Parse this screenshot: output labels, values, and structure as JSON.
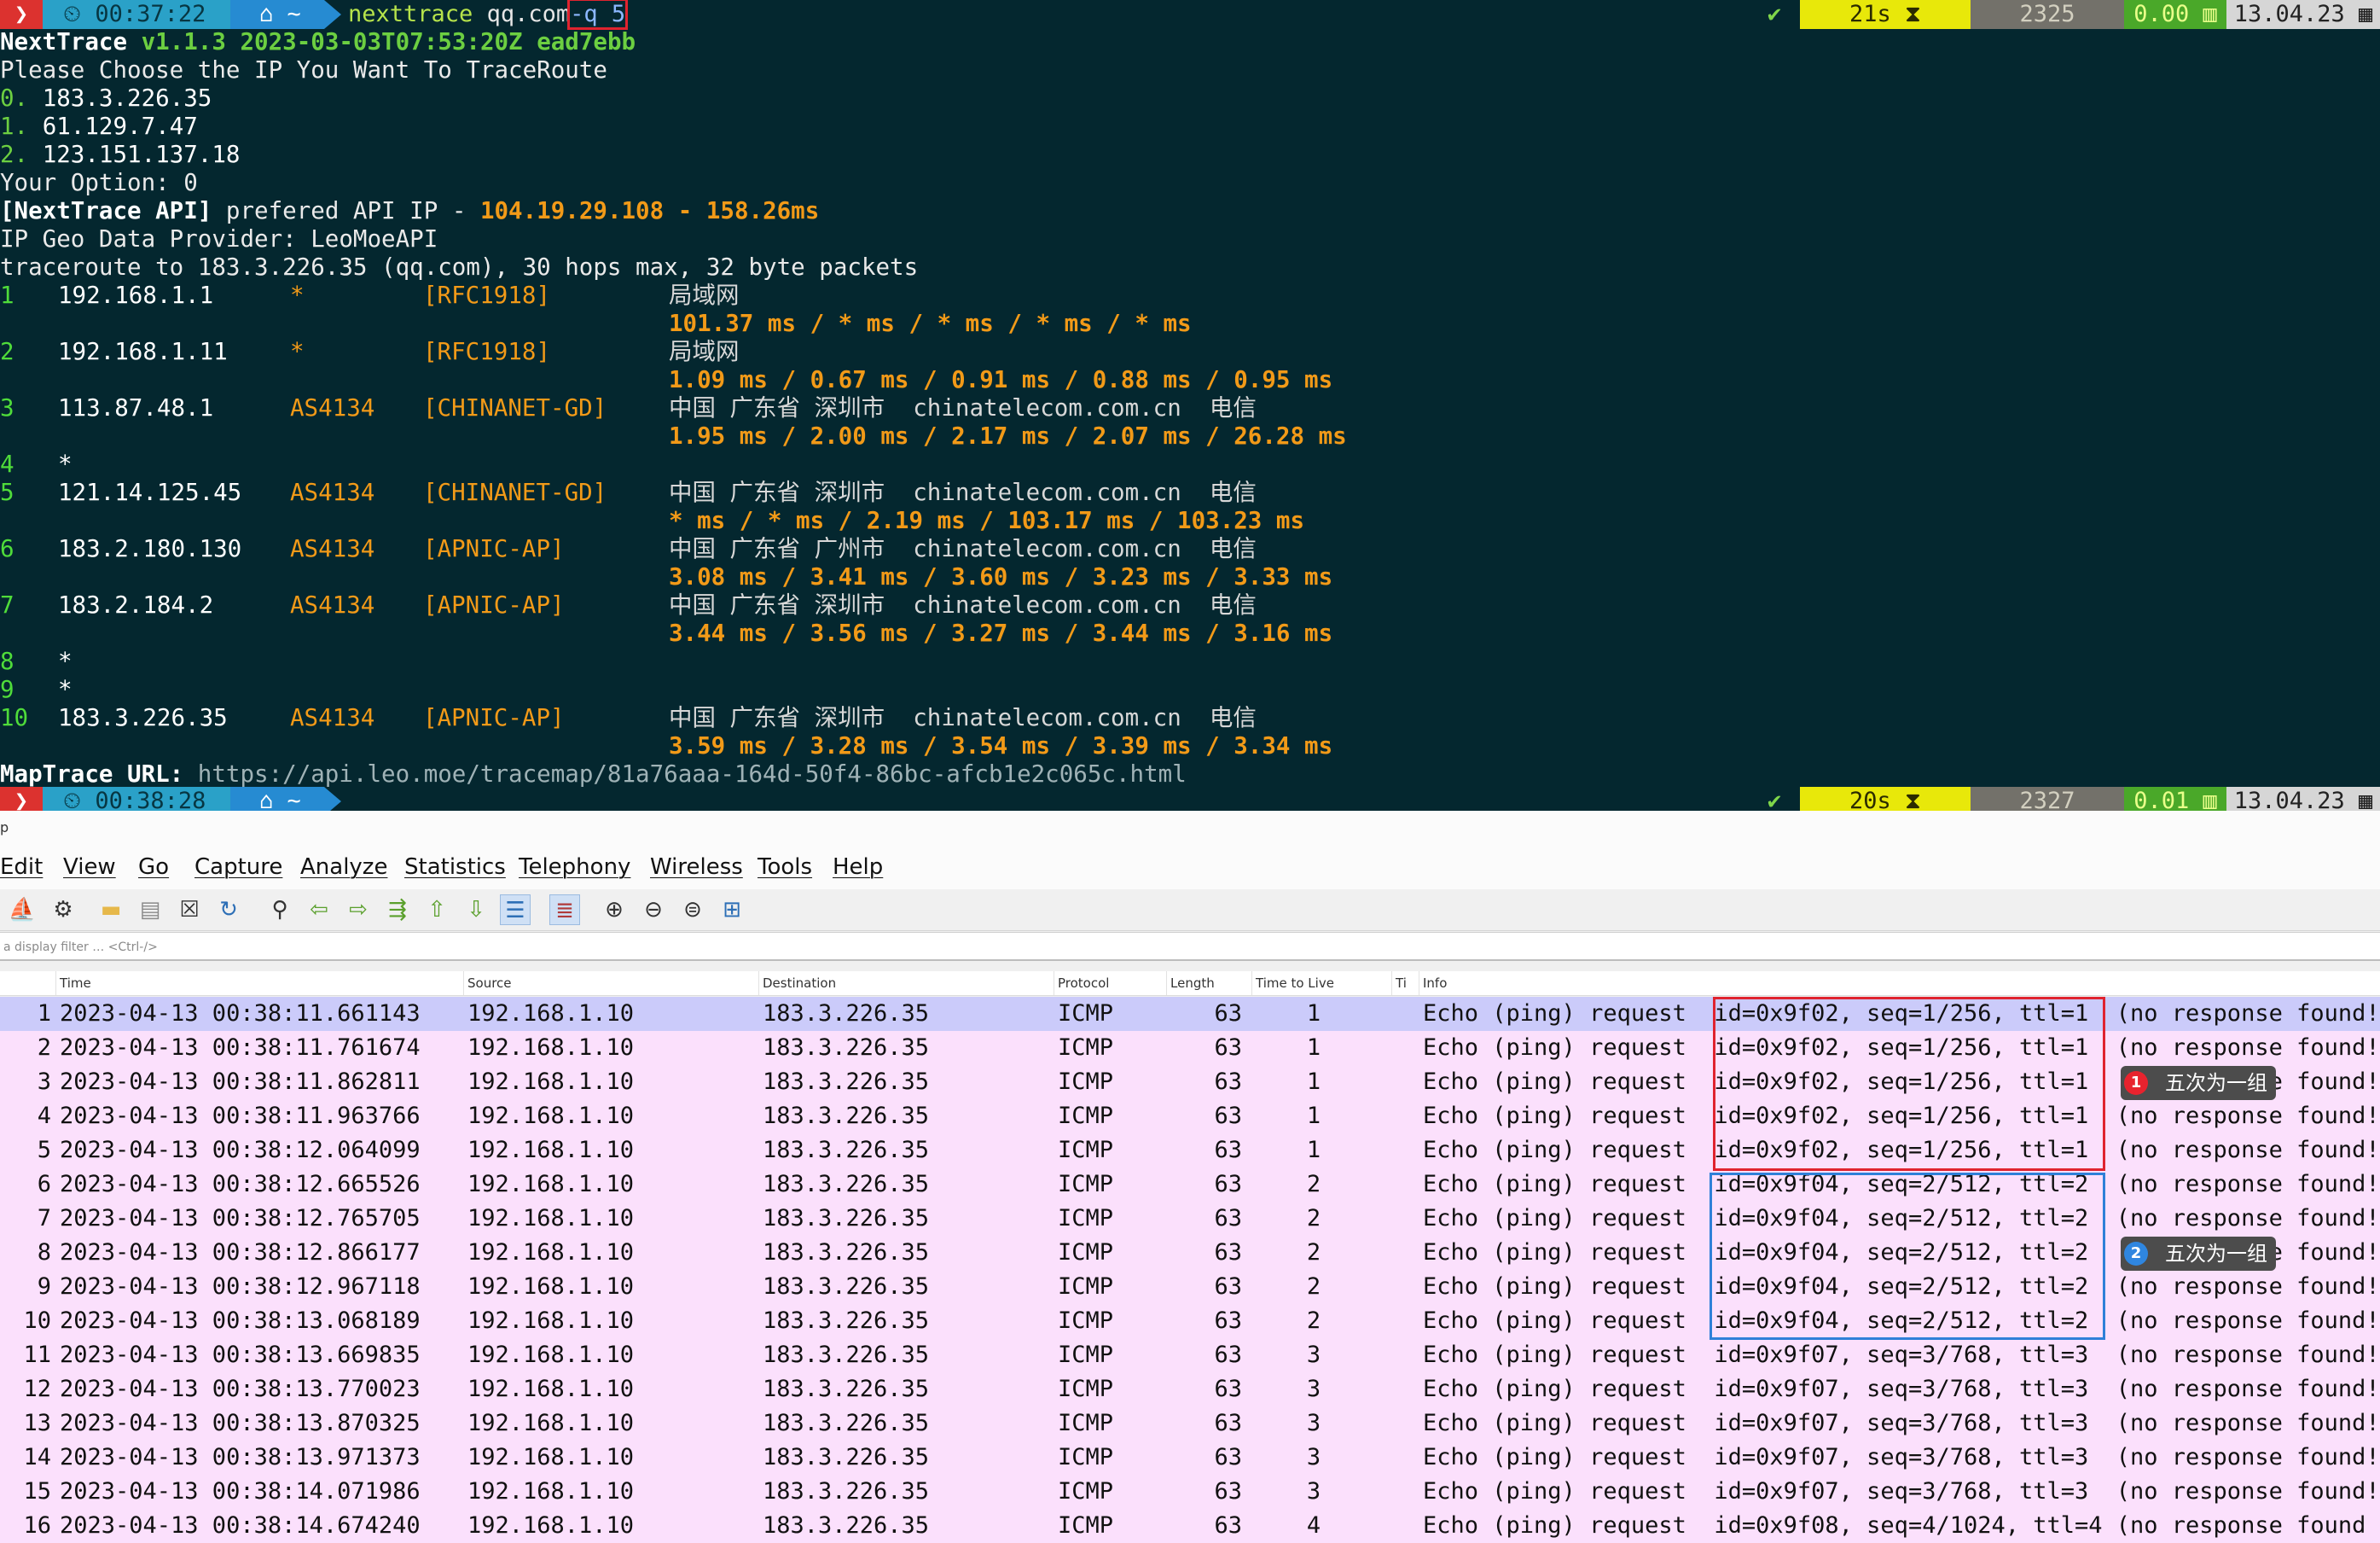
{
  "terminal": {
    "prompt1": {
      "status_icon": "❯",
      "clock_icon": "⏲",
      "clock": "00:37:22",
      "home_icon": "⌂",
      "path": "~",
      "cmd": "nexttrace",
      "arg": "qq.com",
      "opt": "-q 5",
      "check": "✔",
      "duration": "21s ⧗",
      "count": "2325",
      "load": "0.00 ▥",
      "date": "13.04.23 ▦"
    },
    "prompt2": {
      "status_icon": "❯",
      "clock_icon": "⏲",
      "clock": "00:38:28",
      "home_icon": "⌂",
      "path": "~",
      "check": "✔",
      "duration": "20s ⧗",
      "count": "2327",
      "load": "0.01 ▥",
      "date": "13.04.23 ▦"
    },
    "header": {
      "app_name": "NextTrace",
      "version": "v1.1.3",
      "build_time": "2023-03-03T07:53:20Z",
      "commit": "ead7ebb",
      "choose_prompt": "Please Choose the IP You Want To TraceRoute",
      "ip_options": [
        {
          "idx": "0.",
          "ip": "183.3.226.35"
        },
        {
          "idx": "1.",
          "ip": "61.129.7.47"
        },
        {
          "idx": "2.",
          "ip": "123.151.137.18"
        }
      ],
      "option_label": "Your Option: 0",
      "api_tag": "[NextTrace API]",
      "api_text": "prefered API IP - ",
      "api_ip": "104.19.29.108",
      "api_sep": " - ",
      "api_latency": "158.26ms",
      "geo_provider": "IP Geo Data Provider: LeoMoeAPI",
      "traceroute_line": "traceroute to 183.3.226.35 (qq.com), 30 hops max, 32 byte packets"
    },
    "hops": [
      {
        "n": "1",
        "ip": "192.168.1.1",
        "as": "*",
        "net": "[RFC1918]",
        "geo": "局域网",
        "rtt": "101.37 ms / * ms / * ms / * ms / * ms"
      },
      {
        "n": "2",
        "ip": "192.168.1.11",
        "as": "*",
        "net": "[RFC1918]",
        "geo": "局域网",
        "rtt": "1.09 ms / 0.67 ms / 0.91 ms / 0.88 ms / 0.95 ms"
      },
      {
        "n": "3",
        "ip": "113.87.48.1",
        "as": "AS4134",
        "net": "[CHINANET-GD]",
        "geo": "中国 广东省 深圳市  chinatelecom.com.cn  电信",
        "rtt": "1.95 ms / 2.00 ms / 2.17 ms / 2.07 ms / 26.28 ms"
      },
      {
        "n": "4",
        "ip": "*",
        "as": "",
        "net": "",
        "geo": "",
        "rtt": ""
      },
      {
        "n": "5",
        "ip": "121.14.125.45",
        "as": "AS4134",
        "net": "[CHINANET-GD]",
        "geo": "中国 广东省 深圳市  chinatelecom.com.cn  电信",
        "rtt": "* ms / * ms / 2.19 ms / 103.17 ms / 103.23 ms"
      },
      {
        "n": "6",
        "ip": "183.2.180.130",
        "as": "AS4134",
        "net": "[APNIC-AP]",
        "geo": "中国 广东省 广州市  chinatelecom.com.cn  电信",
        "rtt": "3.08 ms / 3.41 ms / 3.60 ms / 3.23 ms / 3.33 ms"
      },
      {
        "n": "7",
        "ip": "183.2.184.2",
        "as": "AS4134",
        "net": "[APNIC-AP]",
        "geo": "中国 广东省 深圳市  chinatelecom.com.cn  电信",
        "rtt": "3.44 ms / 3.56 ms / 3.27 ms / 3.44 ms / 3.16 ms"
      },
      {
        "n": "8",
        "ip": "*",
        "as": "",
        "net": "",
        "geo": "",
        "rtt": ""
      },
      {
        "n": "9",
        "ip": "*",
        "as": "",
        "net": "",
        "geo": "",
        "rtt": ""
      },
      {
        "n": "10",
        "ip": "183.3.226.35",
        "as": "AS4134",
        "net": "[APNIC-AP]",
        "geo": "中国 广东省 深圳市  chinatelecom.com.cn  电信",
        "rtt": "3.59 ms / 3.28 ms / 3.54 ms / 3.39 ms / 3.34 ms"
      }
    ],
    "maptrace_label": "MapTrace URL:",
    "maptrace_url": "https://api.leo.moe/tracemap/81a76aaa-164d-50f4-86bc-afcb1e2c065c.html"
  },
  "wireshark": {
    "title": "p",
    "menu": [
      "Edit",
      "View",
      "Go",
      "Capture",
      "Analyze",
      "Statistics",
      "Telephony",
      "Wireless",
      "Tools",
      "Help"
    ],
    "filter_placeholder": "a display filter … <Ctrl-/>",
    "columns": [
      "Time",
      "Source",
      "Destination",
      "Protocol",
      "Length",
      "Time to Live",
      "Ti",
      "Info"
    ],
    "packets": [
      {
        "no": "1",
        "time": "2023-04-13 00:38:11.661143",
        "src": "192.168.1.10",
        "dst": "183.3.226.35",
        "proto": "ICMP",
        "len": "63",
        "ttl": "1",
        "info": "Echo (ping) request  id=0x9f02, seq=1/256, ttl=1  (no response found!"
      },
      {
        "no": "2",
        "time": "2023-04-13 00:38:11.761674",
        "src": "192.168.1.10",
        "dst": "183.3.226.35",
        "proto": "ICMP",
        "len": "63",
        "ttl": "1",
        "info": "Echo (ping) request  id=0x9f02, seq=1/256, ttl=1  (no response found!"
      },
      {
        "no": "3",
        "time": "2023-04-13 00:38:11.862811",
        "src": "192.168.1.10",
        "dst": "183.3.226.35",
        "proto": "ICMP",
        "len": "63",
        "ttl": "1",
        "info": "Echo (ping) request  id=0x9f02, seq=1/256, ttl=1  (no response found!"
      },
      {
        "no": "4",
        "time": "2023-04-13 00:38:11.963766",
        "src": "192.168.1.10",
        "dst": "183.3.226.35",
        "proto": "ICMP",
        "len": "63",
        "ttl": "1",
        "info": "Echo (ping) request  id=0x9f02, seq=1/256, ttl=1  (no response found!"
      },
      {
        "no": "5",
        "time": "2023-04-13 00:38:12.064099",
        "src": "192.168.1.10",
        "dst": "183.3.226.35",
        "proto": "ICMP",
        "len": "63",
        "ttl": "1",
        "info": "Echo (ping) request  id=0x9f02, seq=1/256, ttl=1  (no response found!"
      },
      {
        "no": "6",
        "time": "2023-04-13 00:38:12.665526",
        "src": "192.168.1.10",
        "dst": "183.3.226.35",
        "proto": "ICMP",
        "len": "63",
        "ttl": "2",
        "info": "Echo (ping) request  id=0x9f04, seq=2/512, ttl=2  (no response found!"
      },
      {
        "no": "7",
        "time": "2023-04-13 00:38:12.765705",
        "src": "192.168.1.10",
        "dst": "183.3.226.35",
        "proto": "ICMP",
        "len": "63",
        "ttl": "2",
        "info": "Echo (ping) request  id=0x9f04, seq=2/512, ttl=2  (no response found!"
      },
      {
        "no": "8",
        "time": "2023-04-13 00:38:12.866177",
        "src": "192.168.1.10",
        "dst": "183.3.226.35",
        "proto": "ICMP",
        "len": "63",
        "ttl": "2",
        "info": "Echo (ping) request  id=0x9f04, seq=2/512, ttl=2  (no response found!"
      },
      {
        "no": "9",
        "time": "2023-04-13 00:38:12.967118",
        "src": "192.168.1.10",
        "dst": "183.3.226.35",
        "proto": "ICMP",
        "len": "63",
        "ttl": "2",
        "info": "Echo (ping) request  id=0x9f04, seq=2/512, ttl=2  (no response found!"
      },
      {
        "no": "10",
        "time": "2023-04-13 00:38:13.068189",
        "src": "192.168.1.10",
        "dst": "183.3.226.35",
        "proto": "ICMP",
        "len": "63",
        "ttl": "2",
        "info": "Echo (ping) request  id=0x9f04, seq=2/512, ttl=2  (no response found!"
      },
      {
        "no": "11",
        "time": "2023-04-13 00:38:13.669835",
        "src": "192.168.1.10",
        "dst": "183.3.226.35",
        "proto": "ICMP",
        "len": "63",
        "ttl": "3",
        "info": "Echo (ping) request  id=0x9f07, seq=3/768, ttl=3  (no response found!"
      },
      {
        "no": "12",
        "time": "2023-04-13 00:38:13.770023",
        "src": "192.168.1.10",
        "dst": "183.3.226.35",
        "proto": "ICMP",
        "len": "63",
        "ttl": "3",
        "info": "Echo (ping) request  id=0x9f07, seq=3/768, ttl=3  (no response found!"
      },
      {
        "no": "13",
        "time": "2023-04-13 00:38:13.870325",
        "src": "192.168.1.10",
        "dst": "183.3.226.35",
        "proto": "ICMP",
        "len": "63",
        "ttl": "3",
        "info": "Echo (ping) request  id=0x9f07, seq=3/768, ttl=3  (no response found!"
      },
      {
        "no": "14",
        "time": "2023-04-13 00:38:13.971373",
        "src": "192.168.1.10",
        "dst": "183.3.226.35",
        "proto": "ICMP",
        "len": "63",
        "ttl": "3",
        "info": "Echo (ping) request  id=0x9f07, seq=3/768, ttl=3  (no response found!"
      },
      {
        "no": "15",
        "time": "2023-04-13 00:38:14.071986",
        "src": "192.168.1.10",
        "dst": "183.3.226.35",
        "proto": "ICMP",
        "len": "63",
        "ttl": "3",
        "info": "Echo (ping) request  id=0x9f07, seq=3/768, ttl=3  (no response found!"
      },
      {
        "no": "16",
        "time": "2023-04-13 00:38:14.674240",
        "src": "192.168.1.10",
        "dst": "183.3.226.35",
        "proto": "ICMP",
        "len": "63",
        "ttl": "4",
        "info": "Echo (ping) request  id=0x9f08, seq=4/1024, ttl=4 (no response found"
      }
    ],
    "callouts": [
      {
        "num": "1",
        "text": "五次为一组"
      },
      {
        "num": "2",
        "text": "五次为一组"
      }
    ],
    "colors": {
      "selected_row": "#cbcbfa",
      "icmp_row": "#fbe0fc",
      "group1_box": "#e0232f",
      "group2_box": "#2f80d8"
    }
  }
}
